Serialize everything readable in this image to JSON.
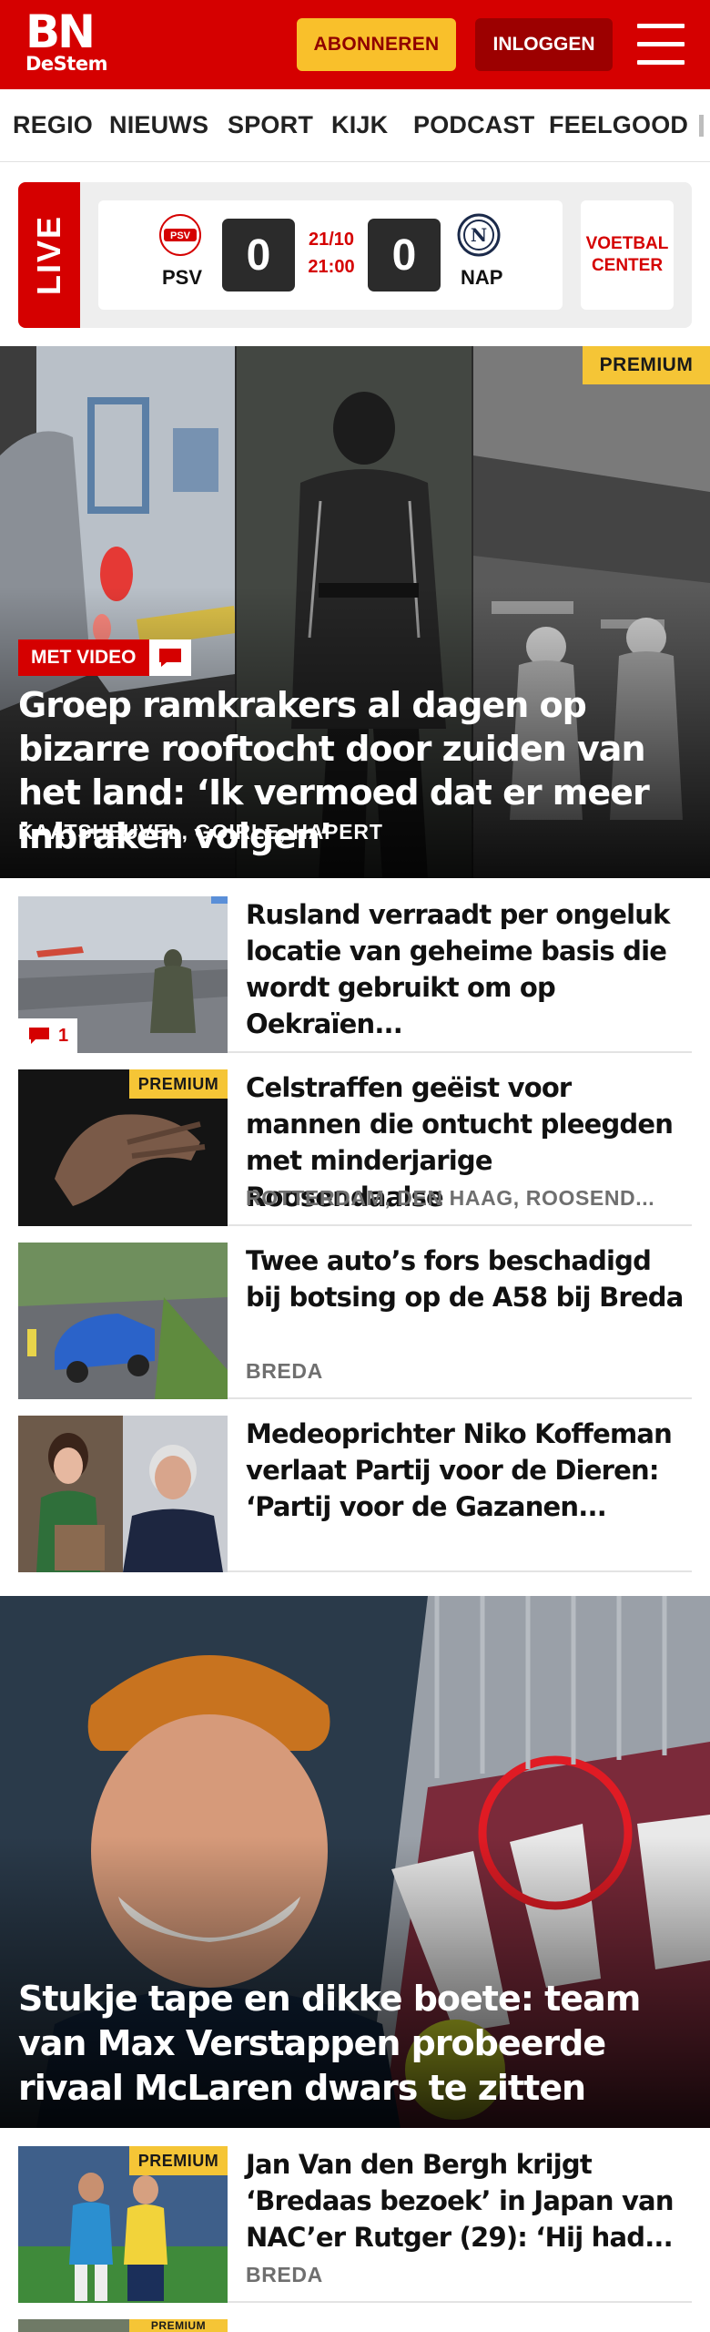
{
  "header": {
    "logo_main": "BN",
    "logo_sub": "DeStem",
    "subscribe_label": "ABONNEREN",
    "login_label": "INLOGGEN",
    "brand_color": "#d50000",
    "accent_color": "#f9c02b"
  },
  "nav": {
    "items": [
      {
        "label": "REGIO"
      },
      {
        "label": "NIEUWS"
      },
      {
        "label": "SPORT"
      },
      {
        "label": "KIJK"
      },
      {
        "label": "PODCAST"
      },
      {
        "label": "FEELGOOD"
      }
    ]
  },
  "live": {
    "tag": "LIVE",
    "home_team": "PSV",
    "home_crest_text": "PSV",
    "home_score": "0",
    "away_team": "NAP",
    "away_crest_text": "N",
    "away_score": "0",
    "date": "21/10",
    "time": "21:00",
    "voetbal_center_line1": "VOETBAL",
    "voetbal_center_line2": "CENTER"
  },
  "hero": {
    "premium_label": "PREMIUM",
    "video_label": "MET VIDEO",
    "title": "Groep ramkrakers al dagen op bizarre rooftocht door zuiden van het land: ‘Ik vermoed dat er meer inbraken volgen’",
    "location": "KAATSHEUVEL, GOIRLE, HAPERT"
  },
  "articles": [
    {
      "title": "Rusland verraadt per ongeluk locatie van geheime basis die wordt gebruikt om op Oekraïen...",
      "location": "",
      "premium": "",
      "comments": "1"
    },
    {
      "title": "Celstraffen geëist voor mannen die ontucht pleegden met minderjarige Roosendaalse",
      "location": "ROTTERDAM, DEN HAAG, ROOSEND...",
      "premium": "PREMIUM",
      "comments": ""
    },
    {
      "title": "Twee auto’s fors beschadigd bij botsing op de A58 bij Breda",
      "location": "BREDA",
      "premium": "",
      "comments": ""
    },
    {
      "title": "Medeoprichter Niko Koffeman verlaat Partij voor de Dieren: ‘Partij voor de Gazanen...",
      "location": "",
      "premium": "",
      "comments": ""
    }
  ],
  "hero2": {
    "title": "Stukje tape en dikke boete: team van Max Verstappen probeerde rivaal McLaren dwars te zitten"
  },
  "articles2": [
    {
      "title": "Jan Van den Bergh krijgt ‘Bredaas bezoek’ in Japan van NAC’er Rutger (29): ‘Hij had...",
      "location": "BREDA",
      "premium": "PREMIUM"
    },
    {
      "premium": "PREMIUM"
    }
  ]
}
